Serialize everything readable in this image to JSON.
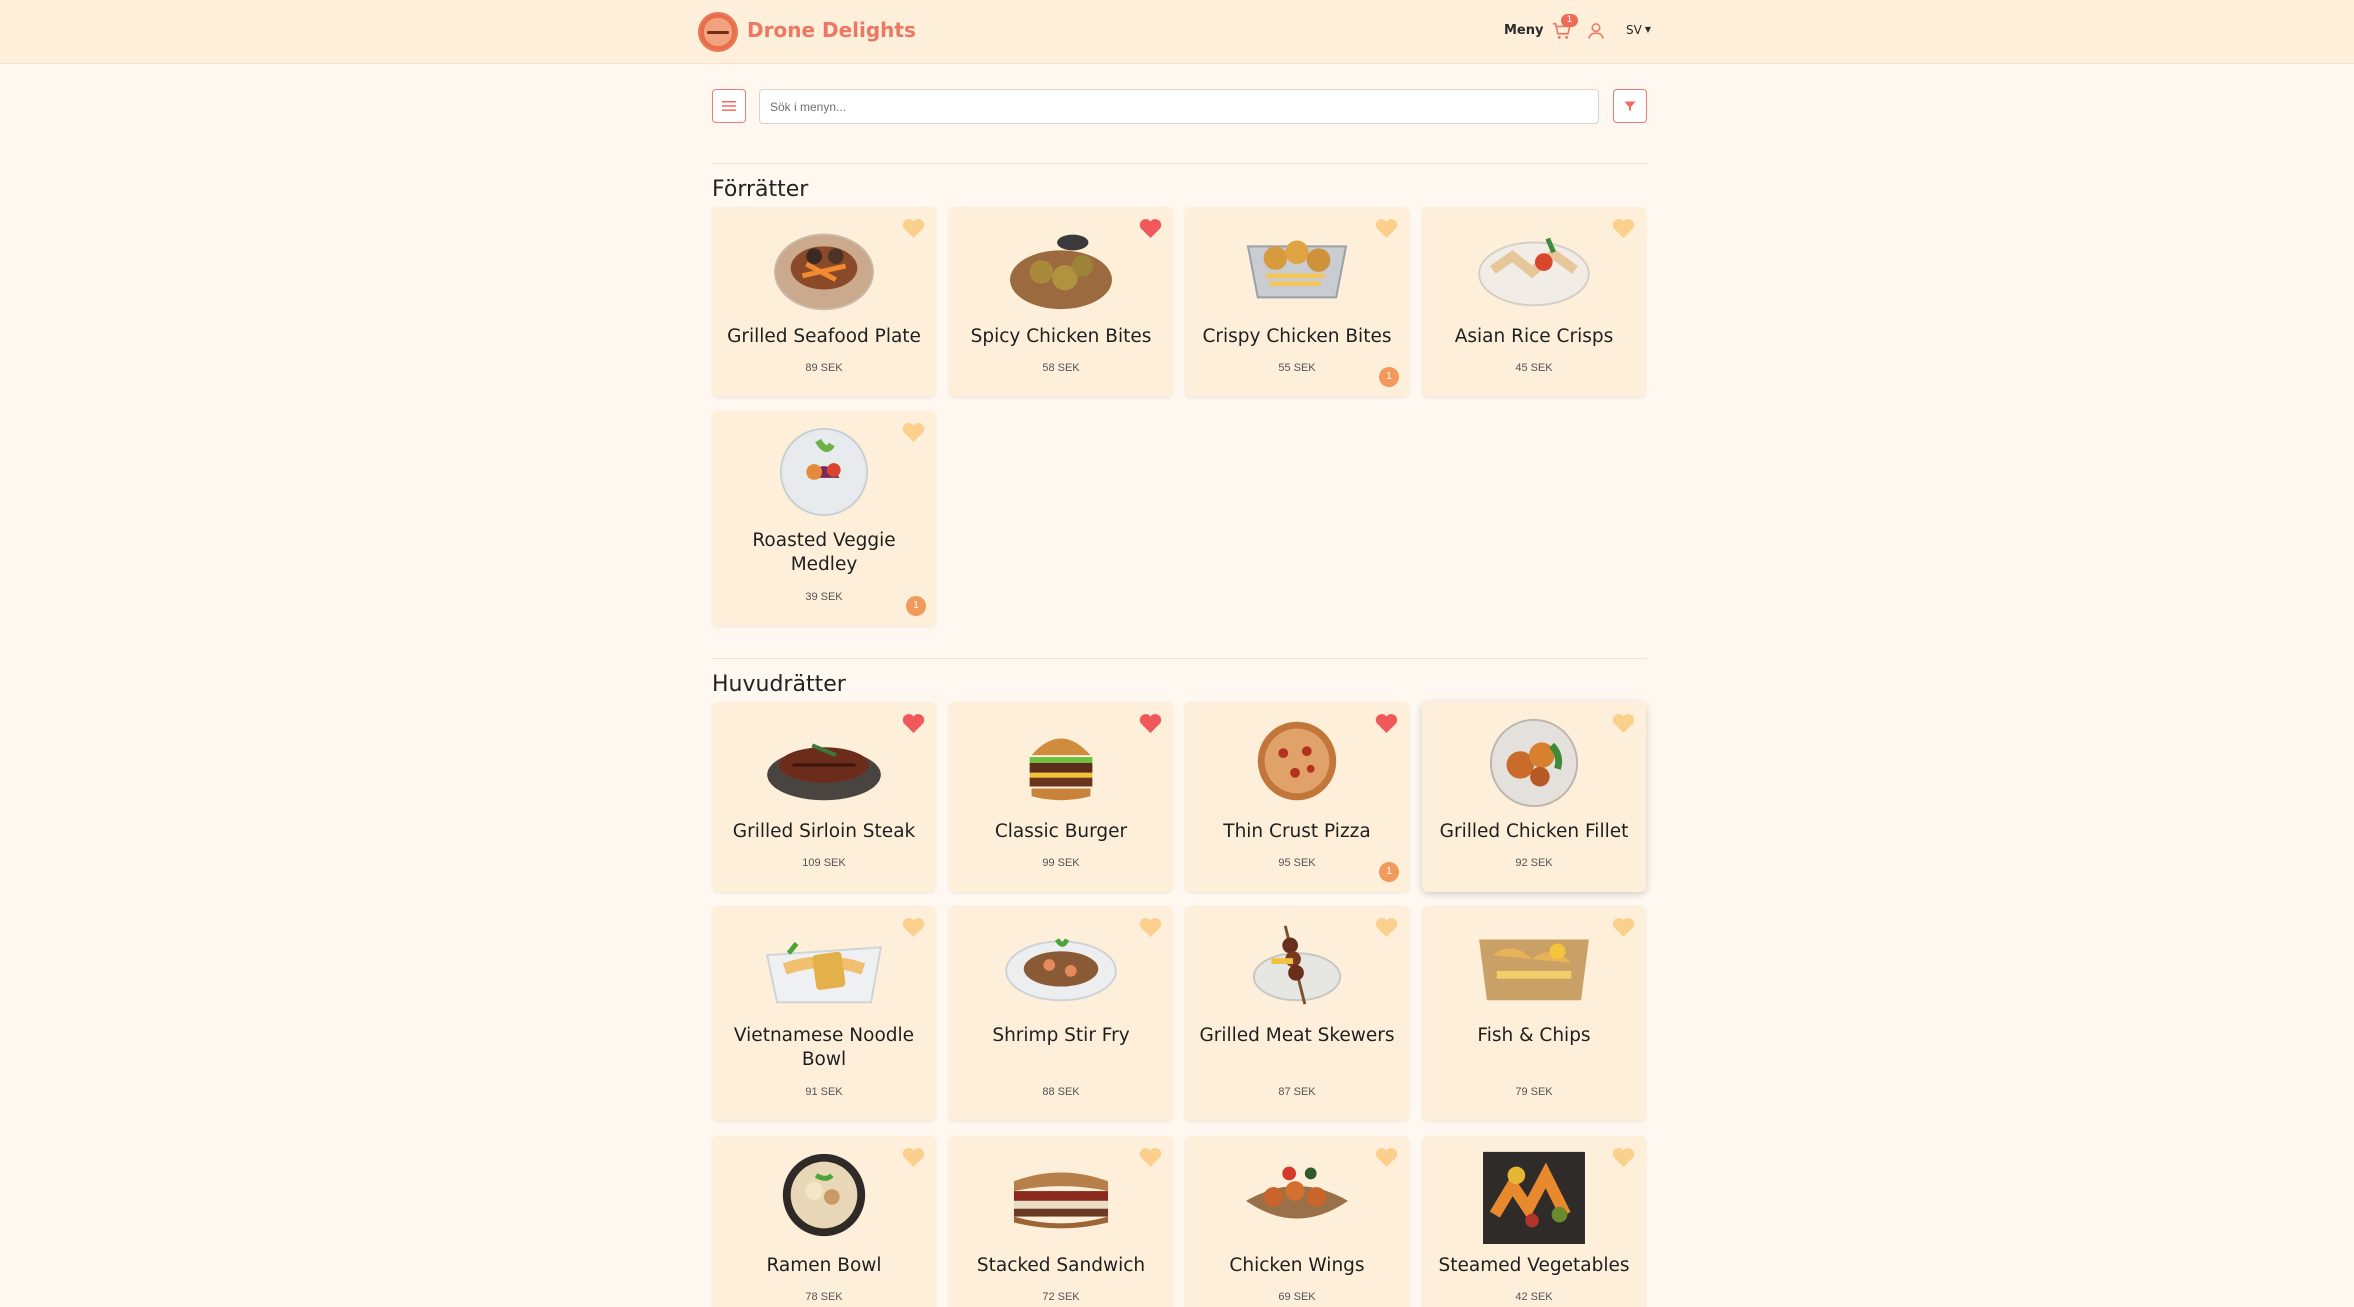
{
  "header": {
    "brand": "Drone Delights",
    "nav_menu": "Meny",
    "cart_count": "1",
    "language": "SV"
  },
  "search": {
    "placeholder": "Sök i menyn..."
  },
  "colors": {
    "accent": "#ec7763",
    "header_bg": "#fdefd9",
    "card_bg": "#fdefd9",
    "page_bg": "#fef8f1",
    "heart_active": "#f0585a",
    "heart_inactive": "#fbd08d",
    "qty_badge": "#f29a5b"
  },
  "sections": [
    {
      "title": "Förrätter",
      "items": [
        {
          "name": "Grilled Seafood Plate",
          "price": "89 SEK",
          "favorite": false,
          "qty": "",
          "icon": "seafood-plate"
        },
        {
          "name": "Spicy Chicken Bites",
          "price": "58 SEK",
          "favorite": true,
          "qty": "",
          "icon": "chicken-bites-bowl"
        },
        {
          "name": "Crispy Chicken Bites",
          "price": "55 SEK",
          "favorite": false,
          "qty": "1",
          "icon": "fried-tray"
        },
        {
          "name": "Asian Rice Crisps",
          "price": "45 SEK",
          "favorite": false,
          "qty": "",
          "icon": "rice-crisps"
        },
        {
          "name": "Roasted Veggie Medley",
          "price": "39 SEK",
          "favorite": false,
          "qty": "1",
          "icon": "veggie-plate"
        }
      ]
    },
    {
      "title": "Huvudrätter",
      "items": [
        {
          "name": "Grilled Sirloin Steak",
          "price": "109 SEK",
          "favorite": true,
          "qty": "",
          "icon": "steak"
        },
        {
          "name": "Classic Burger",
          "price": "99 SEK",
          "favorite": true,
          "qty": "",
          "icon": "burger"
        },
        {
          "name": "Thin Crust Pizza",
          "price": "95 SEK",
          "favorite": true,
          "qty": "1",
          "icon": "pizza"
        },
        {
          "name": "Grilled Chicken Fillet",
          "price": "92 SEK",
          "favorite": false,
          "qty": "",
          "icon": "chicken-fillet"
        },
        {
          "name": "Vietnamese Noodle Bowl",
          "price": "91 SEK",
          "favorite": false,
          "qty": "",
          "icon": "noodle-bowl"
        },
        {
          "name": "Shrimp Stir Fry",
          "price": "88 SEK",
          "favorite": false,
          "qty": "",
          "icon": "stir-fry"
        },
        {
          "name": "Grilled Meat Skewers",
          "price": "87 SEK",
          "favorite": false,
          "qty": "",
          "icon": "skewers"
        },
        {
          "name": "Fish & Chips",
          "price": "79 SEK",
          "favorite": false,
          "qty": "",
          "icon": "fish-chips"
        },
        {
          "name": "Ramen Bowl",
          "price": "78 SEK",
          "favorite": false,
          "qty": "",
          "icon": "ramen"
        },
        {
          "name": "Stacked Sandwich",
          "price": "72 SEK",
          "favorite": false,
          "qty": "",
          "icon": "sandwich"
        },
        {
          "name": "Chicken Wings",
          "price": "69 SEK",
          "favorite": false,
          "qty": "",
          "icon": "wings"
        },
        {
          "name": "Steamed Vegetables",
          "price": "42 SEK",
          "favorite": false,
          "qty": "",
          "icon": "vegetables"
        }
      ]
    }
  ]
}
